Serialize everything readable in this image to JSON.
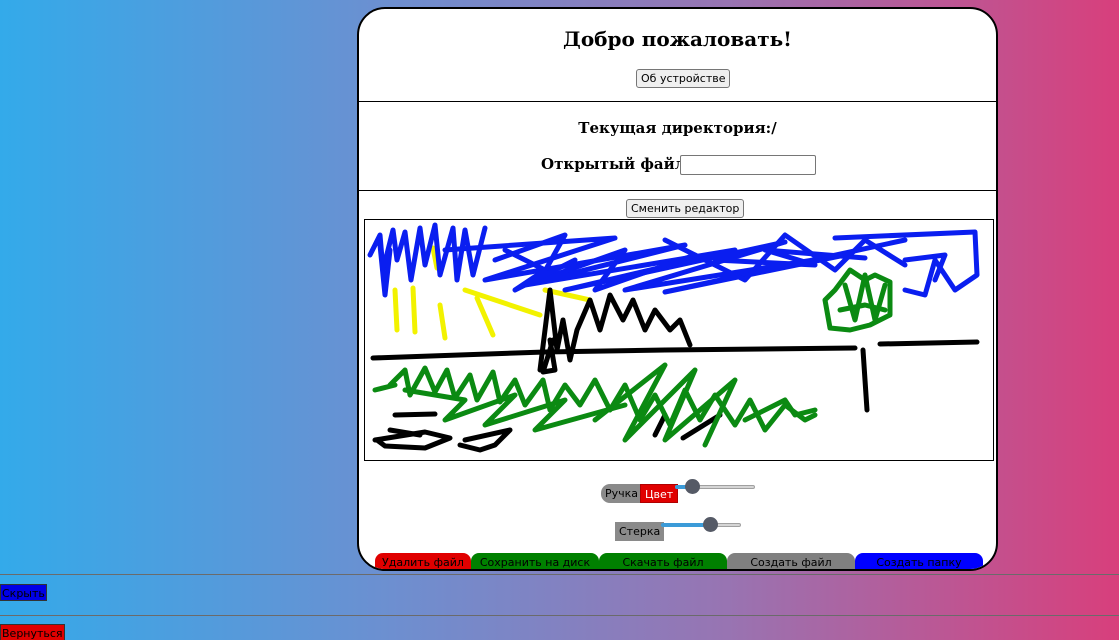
{
  "header": {
    "title": "Добро пожаловать!",
    "about_button": "Об устройстве"
  },
  "files": {
    "current_dir_label": "Текущая директория:/",
    "open_file_label": "Открытый файл:",
    "open_file_value": ""
  },
  "editor": {
    "switch_button": "Сменить редактор",
    "pen_label": "Ручка",
    "color_label": "Цвет",
    "eraser_label": "Стерка",
    "pen_size_fraction": 0.15,
    "eraser_size_fraction": 0.65
  },
  "actions": [
    {
      "label": "Удалить файл",
      "color": "#e00000"
    },
    {
      "label": "Сохранить на диск",
      "color": "#008000"
    },
    {
      "label": "Скачать файл",
      "color": "#008000"
    },
    {
      "label": "Создать файл",
      "color": "#808080"
    },
    {
      "label": "Создать папку",
      "color": "#0000ff"
    }
  ],
  "outer": {
    "hide_button": "Скрыть",
    "back_button": "Вернуться"
  },
  "colors": {
    "gradient_left": "#33aaea",
    "gradient_right": "#d83f7c",
    "drawing_blue": "#0a1ef0",
    "drawing_green": "#0b8a12",
    "drawing_yellow": "#f2f200",
    "drawing_black": "#000000"
  }
}
